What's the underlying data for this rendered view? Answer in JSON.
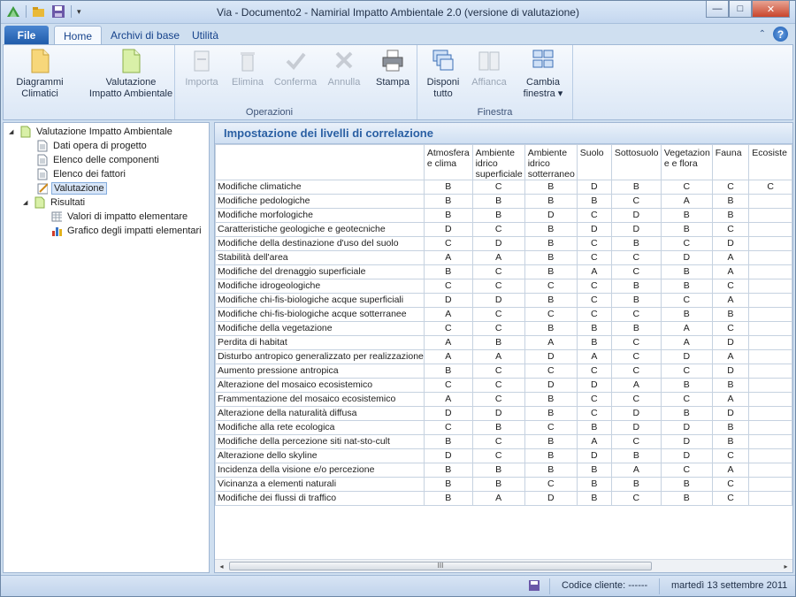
{
  "window": {
    "title": "Via - Documento2 - Namirial Impatto Ambientale 2.0 (versione di valutazione)",
    "controls": [
      "—",
      "□",
      "✕"
    ]
  },
  "ribbon_tabs": [
    {
      "label": "File"
    },
    {
      "label": "Home"
    },
    {
      "label": "Archivi di base"
    },
    {
      "label": "Utilità"
    }
  ],
  "ribbon": {
    "buttons": {
      "diagrammi": "Diagrammi Climatici",
      "valutazione": "Valutazione Impatto Ambientale",
      "importa": "Importa",
      "elimina": "Elimina",
      "conferma": "Conferma",
      "annulla": "Annulla",
      "stampa": "Stampa",
      "disponi": "Disponi tutto",
      "affianca": "Affianca",
      "cambia": "Cambia finestra ▾"
    },
    "groups": {
      "operazioni": "Operazioni",
      "finestra": "Finestra"
    }
  },
  "tree": {
    "root": "Valutazione Impatto Ambientale",
    "items": [
      "Dati opera di progetto",
      "Elenco delle componenti",
      "Elenco dei fattori",
      "Valutazione"
    ],
    "results": "Risultati",
    "results_items": [
      "Valori di impatto elementare",
      "Grafico degli impatti elementari"
    ]
  },
  "panel": {
    "title": "Impostazione dei livelli di correlazione"
  },
  "grid": {
    "columns": [
      "Atmosfera e clima",
      "Ambiente idrico superficiale",
      "Ambiente idrico sotterraneo",
      "Suolo",
      "Sottosuolo",
      "Vegetazion e e flora",
      "Fauna",
      "Ecosiste"
    ],
    "rows": [
      {
        "label": "Modifiche climatiche",
        "values": [
          "B",
          "C",
          "B",
          "D",
          "B",
          "C",
          "C",
          "C"
        ]
      },
      {
        "label": "Modifiche pedologiche",
        "values": [
          "B",
          "B",
          "B",
          "B",
          "C",
          "A",
          "B",
          ""
        ]
      },
      {
        "label": "Modifiche morfologiche",
        "values": [
          "B",
          "B",
          "D",
          "C",
          "D",
          "B",
          "B",
          ""
        ]
      },
      {
        "label": "Caratteristiche geologiche e geotecniche",
        "values": [
          "D",
          "C",
          "B",
          "D",
          "D",
          "B",
          "C",
          ""
        ]
      },
      {
        "label": "Modifiche della destinazione d'uso del suolo",
        "values": [
          "C",
          "D",
          "B",
          "C",
          "B",
          "C",
          "D",
          ""
        ]
      },
      {
        "label": "Stabilità dell'area",
        "values": [
          "A",
          "A",
          "B",
          "C",
          "C",
          "D",
          "A",
          ""
        ]
      },
      {
        "label": "Modifiche del drenaggio superficiale",
        "values": [
          "B",
          "C",
          "B",
          "A",
          "C",
          "B",
          "A",
          ""
        ]
      },
      {
        "label": "Modifiche idrogeologiche",
        "values": [
          "C",
          "C",
          "C",
          "C",
          "B",
          "B",
          "C",
          ""
        ]
      },
      {
        "label": "Modifiche chi-fis-biologiche acque superficiali",
        "values": [
          "D",
          "D",
          "B",
          "C",
          "B",
          "C",
          "A",
          ""
        ]
      },
      {
        "label": "Modifiche chi-fis-biologiche acque sotterranee",
        "values": [
          "A",
          "C",
          "C",
          "C",
          "C",
          "B",
          "B",
          ""
        ]
      },
      {
        "label": "Modifiche della vegetazione",
        "values": [
          "C",
          "C",
          "B",
          "B",
          "B",
          "A",
          "C",
          ""
        ]
      },
      {
        "label": "Perdita di habitat",
        "values": [
          "A",
          "B",
          "A",
          "B",
          "C",
          "A",
          "D",
          ""
        ]
      },
      {
        "label": "Disturbo antropico generalizzato per realizzazione",
        "values": [
          "A",
          "A",
          "D",
          "A",
          "C",
          "D",
          "A",
          ""
        ]
      },
      {
        "label": "Aumento pressione antropica",
        "values": [
          "B",
          "C",
          "C",
          "C",
          "C",
          "C",
          "D",
          ""
        ]
      },
      {
        "label": "Alterazione del mosaico ecosistemico",
        "values": [
          "C",
          "C",
          "D",
          "D",
          "A",
          "B",
          "B",
          ""
        ]
      },
      {
        "label": "Frammentazione del mosaico ecosistemico",
        "values": [
          "A",
          "C",
          "B",
          "C",
          "C",
          "C",
          "A",
          ""
        ]
      },
      {
        "label": "Alterazione della naturalità diffusa",
        "values": [
          "D",
          "D",
          "B",
          "C",
          "D",
          "B",
          "D",
          ""
        ]
      },
      {
        "label": "Modifiche alla rete ecologica",
        "values": [
          "C",
          "B",
          "C",
          "B",
          "D",
          "D",
          "B",
          ""
        ]
      },
      {
        "label": "Modifiche della percezione siti nat-sto-cult",
        "values": [
          "B",
          "C",
          "B",
          "A",
          "C",
          "D",
          "B",
          ""
        ]
      },
      {
        "label": "Alterazione dello skyline",
        "values": [
          "D",
          "C",
          "B",
          "D",
          "B",
          "D",
          "C",
          ""
        ]
      },
      {
        "label": "Incidenza della visione e/o percezione",
        "values": [
          "B",
          "B",
          "B",
          "B",
          "A",
          "C",
          "A",
          ""
        ]
      },
      {
        "label": "Vicinanza a elementi naturali",
        "values": [
          "B",
          "B",
          "C",
          "B",
          "B",
          "B",
          "C",
          ""
        ]
      },
      {
        "label": "Modifiche dei flussi di traffico",
        "values": [
          "B",
          "A",
          "D",
          "B",
          "C",
          "B",
          "C",
          ""
        ]
      }
    ]
  },
  "scrollbar": {
    "thumb_grip": "III",
    "left": "◂",
    "right": "▸"
  },
  "status": {
    "codice": "Codice cliente: ------",
    "date": "martedì 13 settembre 2011"
  },
  "colors": {
    "accent": "#2a5fa3",
    "file_tab": "#1e5aa9",
    "selection": "#d8e6f8"
  }
}
